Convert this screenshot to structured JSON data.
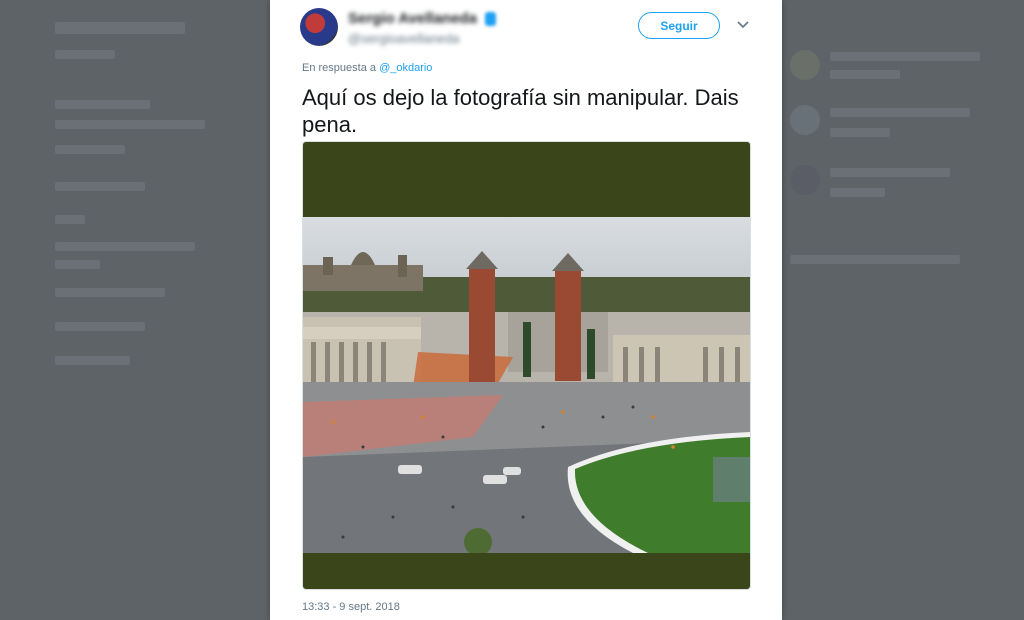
{
  "tweet": {
    "author_name": "Sergio Avellaneda",
    "author_handle": "@sergioavellaneda",
    "follow_label": "Seguir",
    "reply_prefix": "En respuesta a",
    "reply_to": "@_okdario",
    "text": "Aquí os dejo la fotografía sin manipular. Dais pena.",
    "timestamp": "13:33 - 9 sept. 2018"
  },
  "colors": {
    "accent": "#1da1f2",
    "backdrop": "#5e6367",
    "media_letterbox": "#3a4519"
  },
  "icons": {
    "menu": "chevron-down-icon",
    "verified": "verified-badge-icon"
  }
}
